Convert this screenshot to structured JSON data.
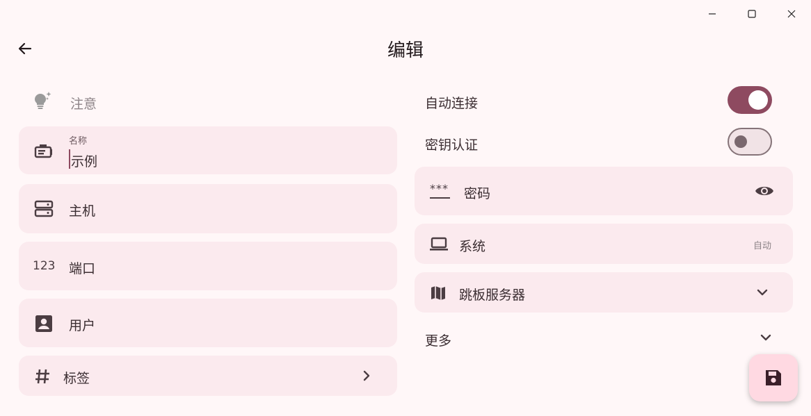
{
  "window": {
    "minimize": "minimize",
    "maximize": "maximize",
    "close": "close"
  },
  "header": {
    "title": "编辑"
  },
  "left": {
    "notice": "注意",
    "name": {
      "label": "名称",
      "value": "示例"
    },
    "host": "主机",
    "port": {
      "icon_text": "123",
      "label": "端口"
    },
    "user": "用户",
    "tags": "标签"
  },
  "right": {
    "auto_connect": {
      "label": "自动连接",
      "on": true
    },
    "key_auth": {
      "label": "密钥认证",
      "on": false
    },
    "password": {
      "icon_text": "***",
      "label": "密码"
    },
    "system": {
      "label": "系统",
      "value": "自动"
    },
    "jump_server": "跳板服务器",
    "more": "更多"
  },
  "colors": {
    "background": "#fff7f8",
    "field": "#fbeaee",
    "accent": "#8e4a60",
    "fab": "#ffd9e2"
  },
  "icons": [
    "arrow-left-icon",
    "lightbulb-icon",
    "badge-icon",
    "server-icon",
    "person-box-icon",
    "hash-icon",
    "chevron-right-icon",
    "password-icon",
    "eye-icon",
    "laptop-icon",
    "map-icon",
    "chevron-down-icon",
    "save-icon"
  ]
}
